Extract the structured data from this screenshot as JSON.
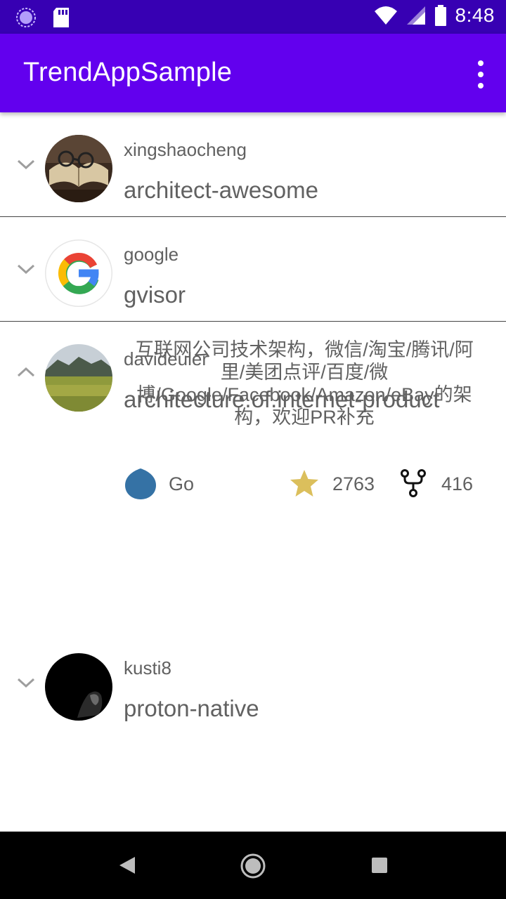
{
  "status_bar": {
    "time": "8:48",
    "icons": [
      "sync-icon",
      "sd-card-icon",
      "wifi-icon",
      "signal-icon",
      "battery-icon"
    ]
  },
  "app_bar": {
    "title": "TrendAppSample",
    "menu_icon": "more-vert-icon"
  },
  "repos": [
    {
      "owner": "xingshaocheng",
      "name": "architect-awesome",
      "expanded": false
    },
    {
      "owner": "google",
      "name": "gvisor",
      "expanded": false
    },
    {
      "owner": "davideuler",
      "name": "architecture.of.internet-product",
      "expanded": true,
      "description": "互联网公司技术架构，微信/淘宝/腾讯/阿里/美团点评/百度/微博/Google/Facebook/Amazon/eBay的架构，欢迎PR补充",
      "language": "Go",
      "language_color": "#3572A5",
      "stars": "2763",
      "forks": "416"
    },
    {
      "owner": "kusti8",
      "name": "proton-native",
      "expanded": false
    }
  ],
  "colors": {
    "status_bar": "#3700b3",
    "app_bar": "#6200ee",
    "star": "#dbbf5c",
    "text": "#616161"
  },
  "nav_bar": {
    "icons": [
      "back-icon",
      "home-icon",
      "recents-icon"
    ]
  }
}
